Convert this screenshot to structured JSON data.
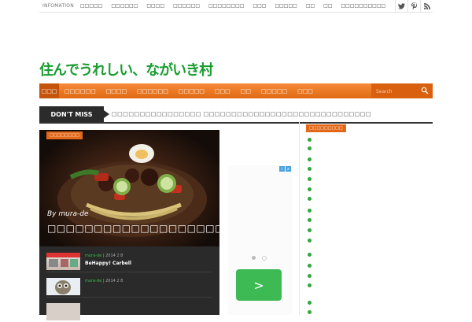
{
  "topbar": {
    "info_label": "INFOMATION",
    "menu": [
      "□□□□□",
      "□□□□□□",
      "□□□□",
      "□□□□□□",
      "□□□□□□□□",
      "□□□",
      "□□□□□",
      "□□",
      "□□",
      "□□□□□□□□□□"
    ],
    "social_icons": [
      "twitter-icon",
      "pinterest-icon",
      "rss-icon"
    ]
  },
  "logo": {
    "text": "住んでうれしい、ながいき村",
    "color": "#1a9c2f"
  },
  "nav": {
    "home_label": "□□□",
    "items": [
      "□□□□□□",
      "□□□□",
      "□□□□□□",
      "□□□□□",
      "□□□",
      "□□",
      "□□□□□",
      "□□□"
    ],
    "search_placeholder": "Search",
    "accent": "#e06a12"
  },
  "dont_miss": {
    "label": "DON'T MISS",
    "ticker": "□□□□□□□□□□□□□□□□ □□□□□□□□□□□□□□□□□□□□□□□□□□□□□□"
  },
  "feature": {
    "tag": "□□□□□□□□",
    "by": "By mura-de",
    "title": "□□□□□□□□□□□□□□□□□□□□□□□□□□□□",
    "posts": [
      {
        "author": "mura-de",
        "date": "2014 2 8",
        "title": "BeHappy! Carbell"
      },
      {
        "author": "mura-de",
        "date": "2014 2 8",
        "title": ""
      }
    ]
  },
  "ad": {
    "badges": [
      "i",
      "x"
    ],
    "go_glyph": ">"
  },
  "sidebar": {
    "heading": "□□□□□□□□□"
  }
}
